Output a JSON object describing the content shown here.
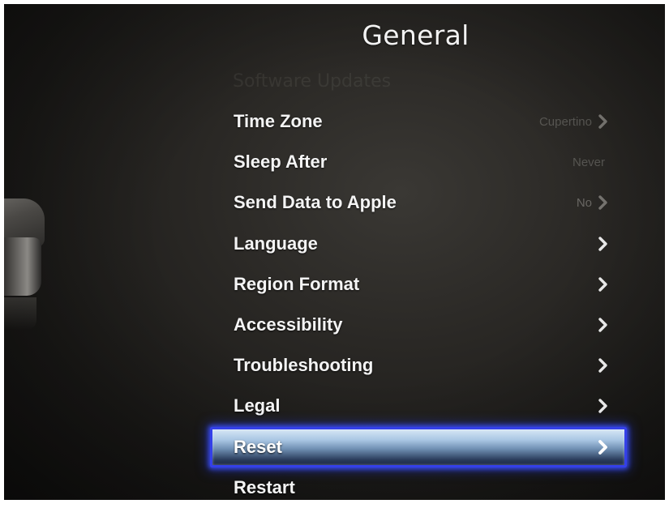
{
  "screen": {
    "title": "General",
    "scrolled_item_above": "Software Updates"
  },
  "menu": {
    "items": [
      {
        "label": "Time Zone",
        "value": "Cupertino",
        "has_chevron": true,
        "selected": false
      },
      {
        "label": "Sleep After",
        "value": "Never",
        "has_chevron": false,
        "selected": false
      },
      {
        "label": "Send Data to Apple",
        "value": "No",
        "has_chevron": true,
        "selected": false
      },
      {
        "label": "Language",
        "value": "",
        "has_chevron": true,
        "selected": false
      },
      {
        "label": "Region Format",
        "value": "",
        "has_chevron": true,
        "selected": false
      },
      {
        "label": "Accessibility",
        "value": "",
        "has_chevron": true,
        "selected": false
      },
      {
        "label": "Troubleshooting",
        "value": "",
        "has_chevron": true,
        "selected": false
      },
      {
        "label": "Legal",
        "value": "",
        "has_chevron": true,
        "selected": false
      },
      {
        "label": "Reset",
        "value": "",
        "has_chevron": true,
        "selected": true
      },
      {
        "label": "Restart",
        "value": "",
        "has_chevron": false,
        "selected": false
      }
    ]
  },
  "icons": {
    "row_chevron": "chevron-right-icon"
  },
  "colors": {
    "selection_border": "#3440e8",
    "selection_glow": "#3c50ff",
    "background": "#2a2825",
    "text": "#f4f4f4"
  }
}
